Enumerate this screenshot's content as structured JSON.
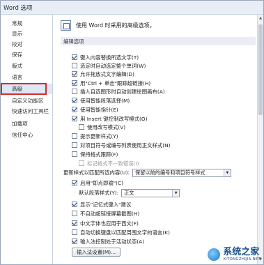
{
  "window": {
    "title": "Word 选项"
  },
  "sidebar": {
    "items": [
      {
        "label": "常规"
      },
      {
        "label": "显示"
      },
      {
        "label": "校对"
      },
      {
        "label": "保存"
      },
      {
        "label": "版式"
      },
      {
        "label": "语言"
      },
      {
        "label": "高级",
        "active": true
      },
      {
        "label": "自定义功能区"
      },
      {
        "label": "快速访问工具栏"
      },
      {
        "label": "加载项"
      },
      {
        "label": "信任中心"
      }
    ]
  },
  "main": {
    "header_text": "使用 Word 时采用的高级选项。",
    "section_title": "编辑选项",
    "options": [
      {
        "label": "键入内容替换所选文字(T)",
        "checked": true
      },
      {
        "label": "选定时自动选定整个单词(W)",
        "checked": false
      },
      {
        "label": "允许拖放式文字编辑(D)",
        "checked": true
      },
      {
        "label": "用\"Ctrl + 单击\"跟踪超链接(H)",
        "checked": true
      },
      {
        "label": "插入自选图形时自动创建绘图画布(A)",
        "checked": false
      },
      {
        "label": "使用智能段落选择(M)",
        "checked": true
      },
      {
        "label": "使用智能指针(E)",
        "checked": true
      },
      {
        "label": "用 Insert 键控制改写模式(O)",
        "checked": true
      },
      {
        "label": "使用改写模式(V)",
        "checked": false,
        "indent": true
      },
      {
        "label": "提示更新样式(Y)",
        "checked": false
      },
      {
        "label": "对项目符号或编号列表使用正文样式(N)",
        "checked": false
      },
      {
        "label": "保持格式跟踪(F)",
        "checked": false
      },
      {
        "label": "标记格式不一致错误(I)",
        "checked": false,
        "indent": true,
        "disabled": true
      }
    ],
    "paste_format": {
      "label": "更新样式以匹配所选内容(U):",
      "value": "保留以前的编号和项目符号样式"
    },
    "options2": [
      {
        "label": "启用\"即点即输\"(C)",
        "checked": true
      }
    ],
    "default_paragraph": {
      "label": "默认段落样式(Y):",
      "value": "正文"
    },
    "options3": [
      {
        "label": "显示\"记忆式键入\"建议",
        "checked": true
      },
      {
        "label": "不自动超链接屏幕截图(H)",
        "checked": false
      },
      {
        "label": "中文字体也应用于西文(F)",
        "checked": true
      },
      {
        "label": "自动切换键盘以匹配周围文字的语言(K)",
        "checked": false
      },
      {
        "label": "输入法控制处于活动状态(A)",
        "checked": true
      }
    ],
    "ime_button": "输入法设置(M)..."
  },
  "watermark": {
    "main": "系统之家",
    "sub": "XITONGZHIJIA.NET"
  },
  "icons": {
    "settings": "settings-icon",
    "dropdown": "chevron-down-icon"
  }
}
